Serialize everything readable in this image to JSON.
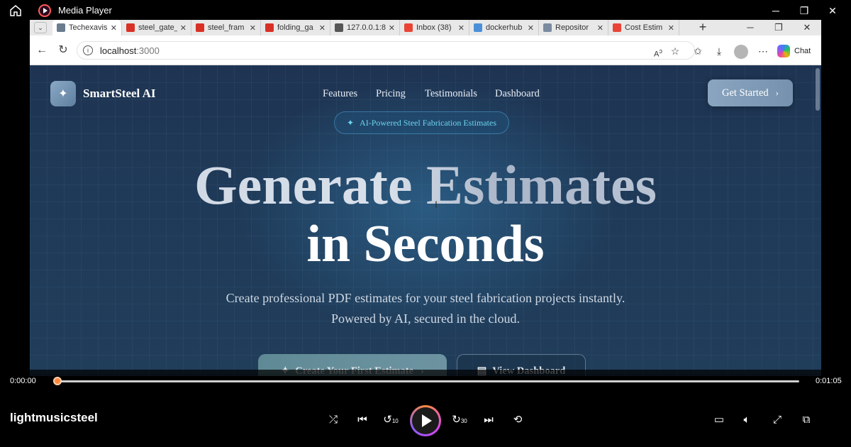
{
  "player": {
    "app_title": "Media Player",
    "track_title": "lightmusicsteel",
    "time_elapsed": "0:00:00",
    "time_total": "0:01:05",
    "progress_fraction": 0.0,
    "accent_color": "#ff8a3d",
    "skip_back_label": "10",
    "skip_forward_label": "30"
  },
  "browser": {
    "tabs": [
      {
        "label": "Techexavis",
        "icon": "site-favicon",
        "active": true
      },
      {
        "label": "steel_gate_",
        "icon": "pdf-icon",
        "active": false
      },
      {
        "label": "steel_fram",
        "icon": "pdf-icon",
        "active": false
      },
      {
        "label": "folding_ga",
        "icon": "pdf-icon",
        "active": false
      },
      {
        "label": "127.0.0.1:8",
        "icon": "globe-icon",
        "active": false
      },
      {
        "label": "Inbox (38)",
        "icon": "gmail-icon",
        "active": false
      },
      {
        "label": "dockerhub",
        "icon": "search-icon",
        "active": false
      },
      {
        "label": "Repositor",
        "icon": "docker-icon",
        "active": false
      },
      {
        "label": "Cost Estim",
        "icon": "gmail-icon",
        "active": false
      }
    ],
    "url_host": "localhost",
    "url_port": ":3000",
    "chat_label": "Chat"
  },
  "page": {
    "brand": "SmartSteel AI",
    "nav": [
      "Features",
      "Pricing",
      "Testimonials",
      "Dashboard"
    ],
    "cta_top": "Get Started",
    "badge": "AI-Powered Steel Fabrication Estimates",
    "hero_line1": "Generate Estimates",
    "hero_line2": "in Seconds",
    "subtitle_line1": "Create professional PDF estimates for your steel fabrication projects instantly.",
    "subtitle_line2": "Powered by AI, secured in the cloud.",
    "primary_button": "Create Your First Estimate",
    "secondary_button": "View Dashboard"
  }
}
